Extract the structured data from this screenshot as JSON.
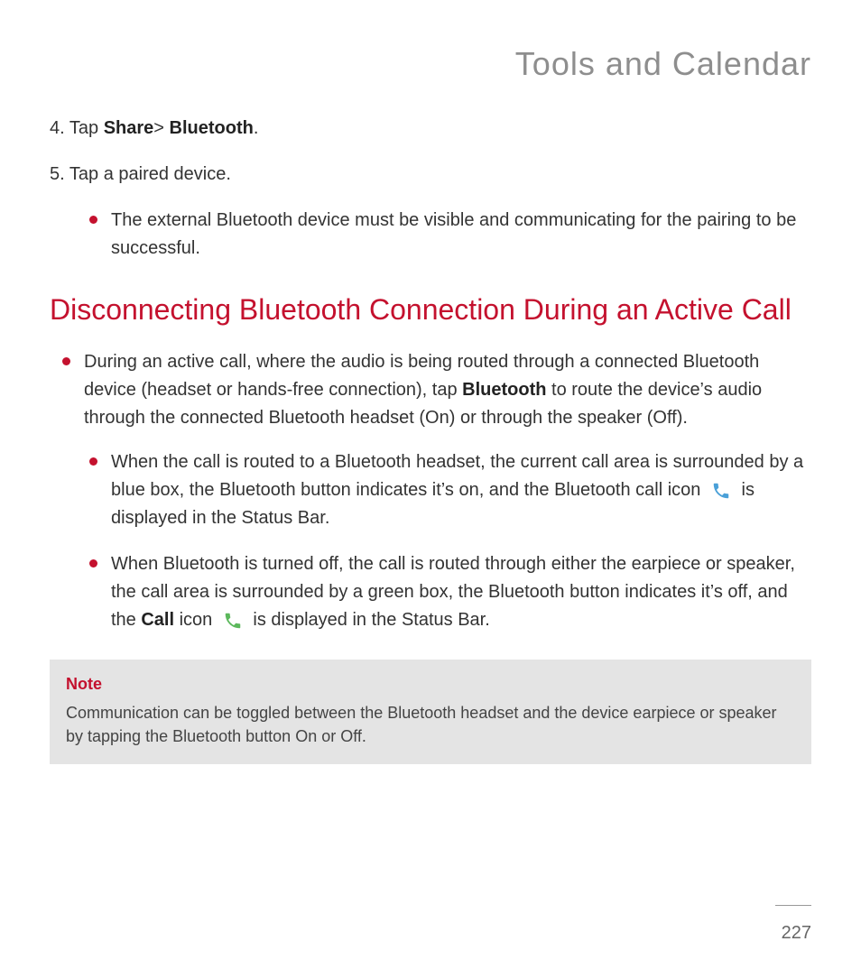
{
  "header": {
    "section_title": "Tools and Calendar"
  },
  "steps": [
    {
      "num": "4.",
      "pre": "Tap ",
      "b1": "Share",
      "sep": "> ",
      "b2": "Bluetooth",
      "post": "."
    },
    {
      "num": "5.",
      "text": "Tap a paired device."
    }
  ],
  "step5_sub": "The external Bluetooth device must be visible and communicating for the pairing to be successful.",
  "h2": "Disconnecting Bluetooth Connection During an Active Call",
  "main_bullet": {
    "a": "During an active call, where the audio is being routed through a connected Bluetooth device (headset or hands-free connection), tap ",
    "b": "Bluetooth",
    "c": " to route the device’s audio through the connected Bluetooth headset (On) or through the speaker (Off)."
  },
  "sub_bullets": [
    {
      "a": "When the call is routed to a Bluetooth headset, the current call area is surrounded by a blue box, the Bluetooth button indicates it’s on, and the Bluetooth call icon ",
      "c": " is displayed in the Status Bar.",
      "icon": "bluetooth-call-icon",
      "icon_color": "#4aa0d8"
    },
    {
      "a": "When Bluetooth is turned off, the call is routed through either the earpiece or speaker, the call area is surrounded by a green box, the Bluetooth button indicates it’s off, and the ",
      "b": "Call",
      "c": " icon ",
      "d": " is displayed in the Status Bar.",
      "icon": "call-icon",
      "icon_color": "#5cb85c"
    }
  ],
  "note": {
    "title": "Note",
    "body": "Communication can be toggled between the Bluetooth headset and the device earpiece or speaker by tapping the Bluetooth button On or Off."
  },
  "page_number": "227"
}
